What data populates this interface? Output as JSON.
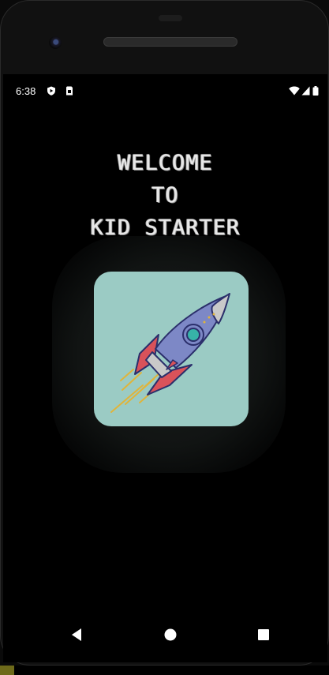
{
  "status_bar": {
    "time": "6:38",
    "icons": [
      "shield-play-icon",
      "sim-card-icon",
      "wifi-icon",
      "signal-icon",
      "battery-icon"
    ]
  },
  "welcome": {
    "lines": [
      "WELCOME",
      "TO",
      "KID STARTER"
    ]
  },
  "app_icon": {
    "name": "rocket-icon",
    "tile_color": "#9bcbc4"
  },
  "nav_bar": {
    "buttons": [
      "back",
      "home",
      "recents"
    ]
  },
  "colors": {
    "background": "#000000",
    "text": "#e8e8e8",
    "rocket_body": "#7d88c6",
    "rocket_fin": "#d9525a",
    "rocket_tip": "#c9c9c9",
    "exhaust": "#e0b43a"
  }
}
